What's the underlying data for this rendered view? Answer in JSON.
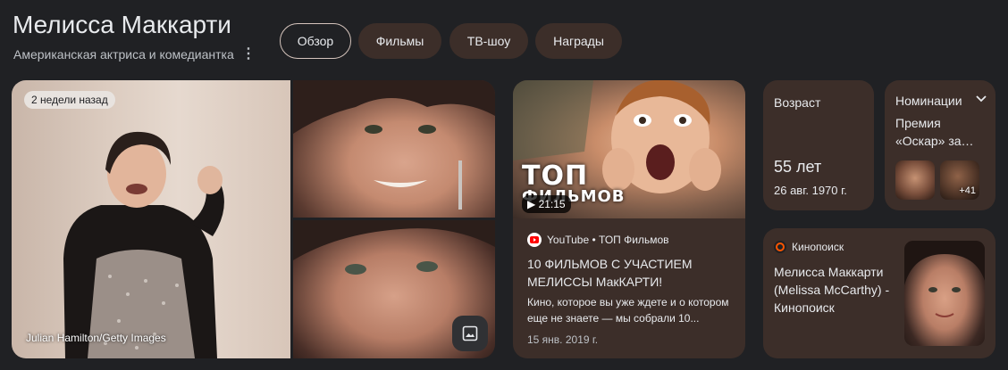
{
  "header": {
    "title": "Мелисса Маккарти",
    "subtitle": "Американская актриса и комедиантка",
    "tabs": [
      {
        "label": "Обзор",
        "active": true
      },
      {
        "label": "Фильмы",
        "active": false
      },
      {
        "label": "ТВ-шоу",
        "active": false
      },
      {
        "label": "Награды",
        "active": false
      }
    ]
  },
  "images": {
    "badge": "2 недели назад",
    "credit": "Julian Hamilton/Getty Images"
  },
  "video": {
    "thumb_line1": "ТОП",
    "thumb_line2": "ФИЛЬМОВ",
    "duration": "21:15",
    "source": "YouTube • ТОП Фильмов",
    "title": "10 ФИЛЬМОВ С УЧАСТИЕМ МЕЛИССЫ МакКАРТИ!",
    "description": "Кино, которое вы уже ждете и о котором еще не знаете — мы собрали 10...",
    "date": "15 янв. 2019 г."
  },
  "age": {
    "label": "Возраст",
    "value": "55 лет",
    "birthdate": "26 авг. 1970 г."
  },
  "nominations": {
    "label": "Номинации",
    "text": "Премия «Оскар» за…",
    "more": "+41"
  },
  "kinopoisk": {
    "source": "Кинопоиск",
    "title": "Мелисса Маккарти (Melissa McCarthy) - Кинопоиск"
  },
  "colors": {
    "background": "#202124",
    "card": "#3c2e29",
    "text": "#e8eaed",
    "youtube_red": "#ff0000",
    "kinopoisk_orange": "#ff5500"
  }
}
